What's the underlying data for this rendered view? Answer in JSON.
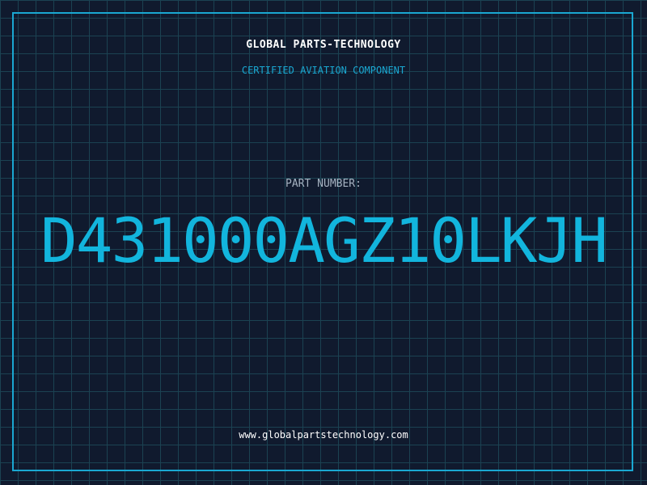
{
  "header": {
    "company": "GLOBAL PARTS-TECHNOLOGY",
    "subtitle": "CERTIFIED AVIATION COMPONENT"
  },
  "part": {
    "label": "PART NUMBER:",
    "number": "D431000AGZ10LKJH"
  },
  "footer": {
    "website": "www.globalpartstechnology.com"
  },
  "colors": {
    "background": "#101a2e",
    "grid": "#1b4252",
    "accent": "#12b5dd",
    "label": "#a6b3c2",
    "text": "#ffffff"
  }
}
